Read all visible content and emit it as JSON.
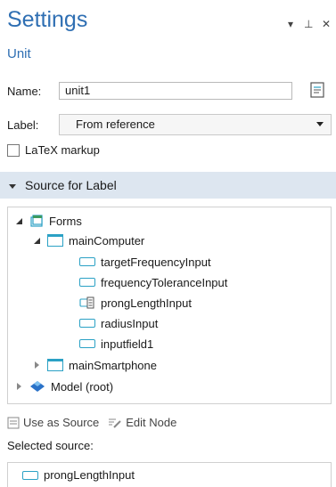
{
  "panel": {
    "title": "Settings",
    "subtitle": "Unit"
  },
  "form": {
    "name_label": "Name:",
    "name_value": "unit1",
    "label_label": "Label:",
    "label_value": "From reference",
    "latex_label": "LaTeX markup",
    "latex_checked": false
  },
  "section": {
    "title": "Source for Label"
  },
  "tree": {
    "forms": "Forms",
    "main_computer": "mainComputer",
    "children": [
      "targetFrequencyInput",
      "frequencyToleranceInput",
      "prongLengthInput",
      "radiusInput",
      "inputfield1"
    ],
    "main_smartphone": "mainSmartphone",
    "model_root": "Model (root)"
  },
  "toolbar": {
    "use_as_source": "Use as Source",
    "edit_node": "Edit Node"
  },
  "selected": {
    "label": "Selected source:",
    "value": "prongLengthInput"
  },
  "colors": {
    "accent": "#2f6fb3",
    "section_bg": "#dde6f0",
    "icon": "#2ba1c5"
  }
}
